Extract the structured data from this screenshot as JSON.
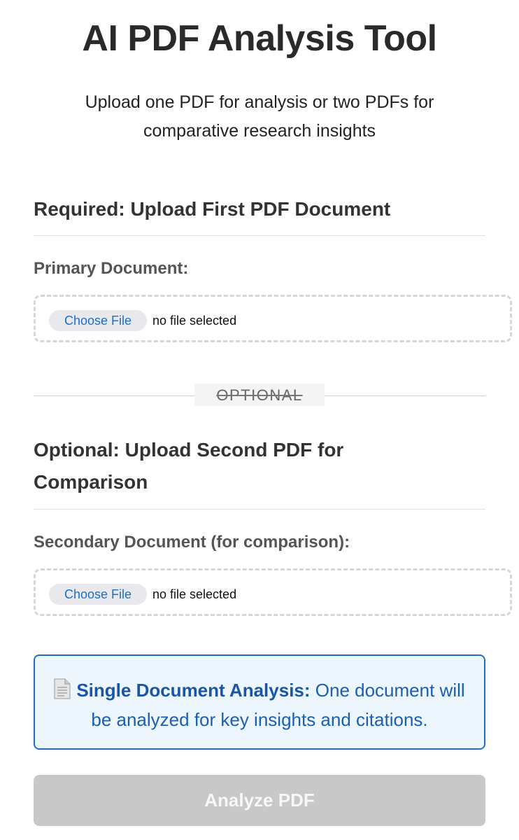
{
  "header": {
    "title": "AI PDF Analysis Tool",
    "subtitle": "Upload one PDF for analysis or two PDFs for comparative research insights"
  },
  "required_section": {
    "heading": "Required: Upload First PDF Document",
    "field_label": "Primary Document:",
    "choose_file_label": "Choose File",
    "file_status": "no file selected"
  },
  "divider": {
    "label": "OPTIONAL"
  },
  "optional_section": {
    "heading": "Optional: Upload Second PDF for Comparison",
    "field_label": "Secondary Document (for comparison):",
    "choose_file_label": "Choose File",
    "file_status": "no file selected"
  },
  "info": {
    "icon": "document-icon",
    "title": "Single Document Analysis:",
    "text": " One document will be analyzed for key insights and citations."
  },
  "actions": {
    "analyze_label": "Analyze PDF",
    "analyze_enabled": false
  },
  "colors": {
    "accent": "#1f6fc7",
    "info_background": "#eef6fd",
    "disabled_button": "#c8c8c8",
    "file_button_text": "#1e6fc4"
  }
}
